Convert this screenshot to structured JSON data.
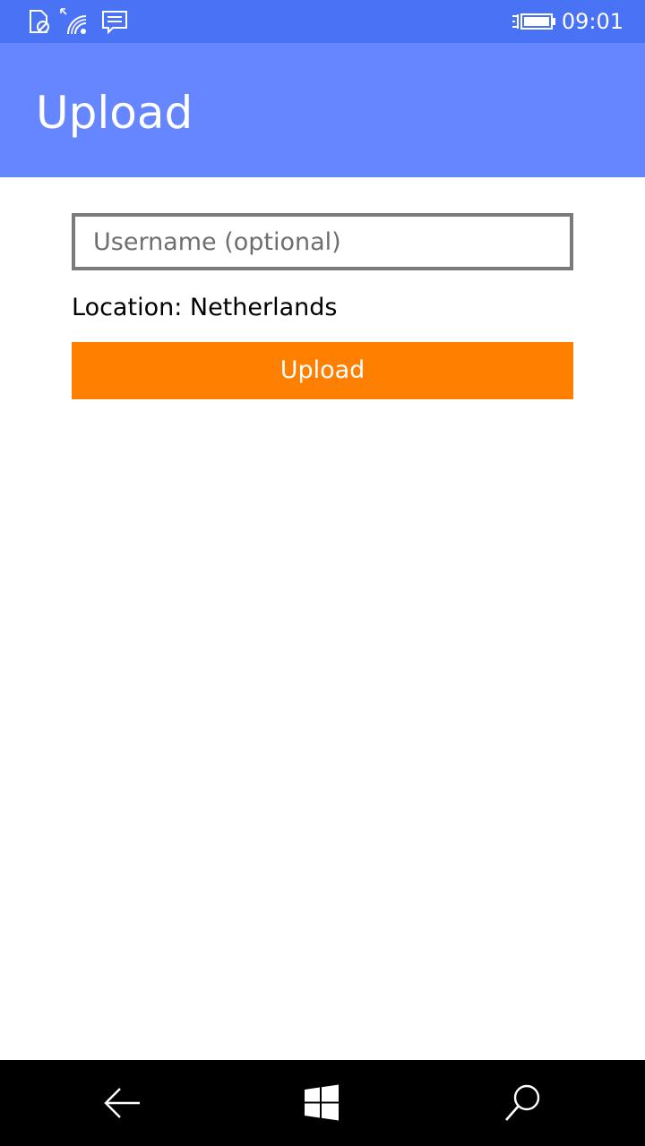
{
  "status_bar": {
    "time": "09:01",
    "icons": [
      "notification-blocked-icon",
      "wifi-icon",
      "message-icon",
      "battery-charging-icon"
    ],
    "color": "#4a72f5"
  },
  "header": {
    "title": "Upload",
    "color": "#6586fe"
  },
  "form": {
    "username": {
      "value": "",
      "placeholder": "Username (optional)"
    },
    "location_text": "Location: Netherlands",
    "upload_button_label": "Upload",
    "upload_button_color": "#ff8000"
  },
  "nav_bar": {
    "buttons": [
      "back-arrow-icon",
      "windows-start-icon",
      "search-icon"
    ]
  }
}
